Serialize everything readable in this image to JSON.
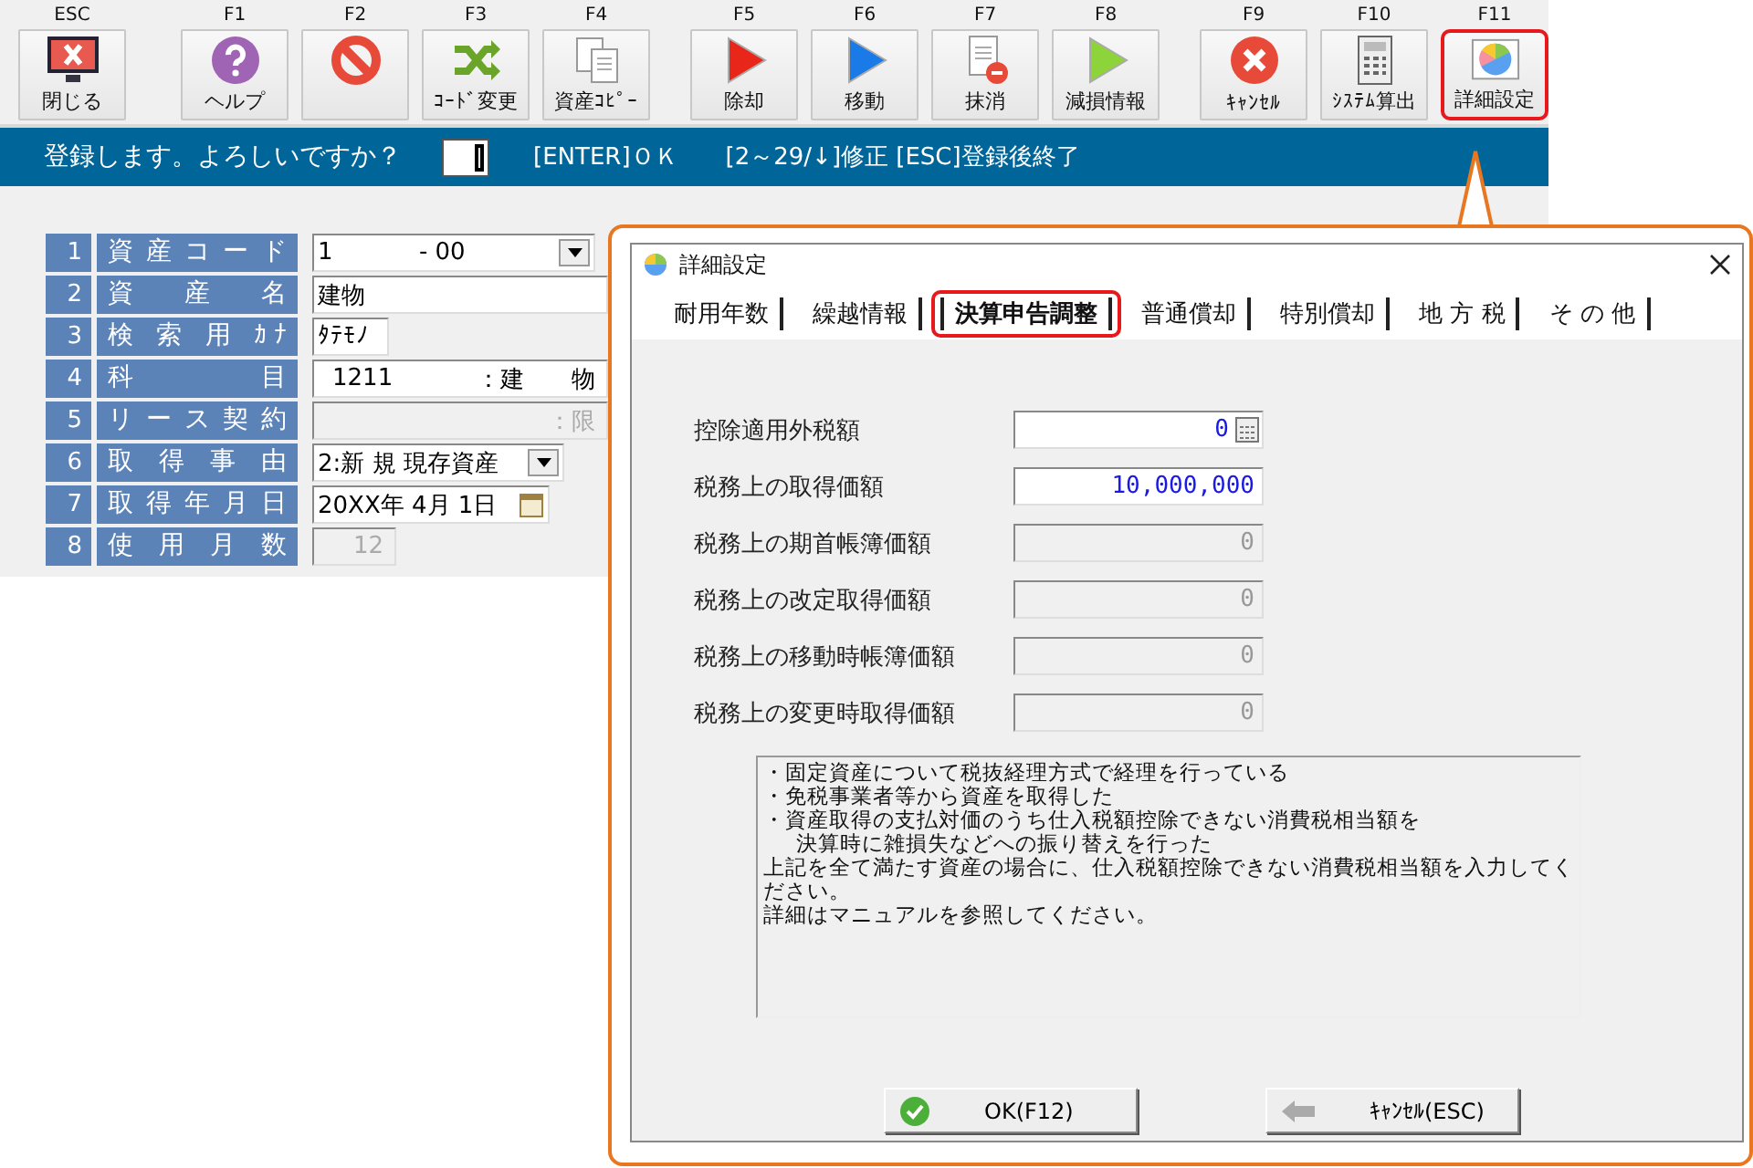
{
  "toolbar": {
    "buttons": [
      {
        "key": "ESC",
        "label": "閉じる",
        "kind": "close-monitor",
        "highlighted": false
      },
      {
        "key": "F1",
        "label": "ヘルプ",
        "kind": "help",
        "highlighted": false
      },
      {
        "key": "F2",
        "kind": "prohibit",
        "highlighted": false
      },
      {
        "key": "F3",
        "label": "ｺｰﾄﾞ変更",
        "kind": "shuffle",
        "highlighted": false
      },
      {
        "key": "F4",
        "label": "資産ｺﾋﾟｰ",
        "kind": "copy",
        "highlighted": false
      },
      {
        "key": "F5",
        "label": "除却",
        "kind": "play-red",
        "highlighted": false
      },
      {
        "key": "F6",
        "label": "移動",
        "kind": "play-blue",
        "highlighted": false
      },
      {
        "key": "F7",
        "label": "抹消",
        "kind": "doc-remove",
        "highlighted": false
      },
      {
        "key": "F8",
        "label": "減損情報",
        "kind": "play-green",
        "highlighted": false
      },
      {
        "key": "F9",
        "label": "ｷｬﾝｾﾙ",
        "kind": "cancel",
        "highlighted": false
      },
      {
        "key": "F10",
        "label": "ｼｽﾃﾑ算出",
        "kind": "calculator",
        "highlighted": false
      },
      {
        "key": "F11",
        "label": "詳細設定",
        "kind": "pie",
        "highlighted": true
      }
    ]
  },
  "prompt_bar": {
    "message": "登録します。よろしいですか？",
    "hints": [
      "[ENTER]ＯＫ",
      "[2～29/↓]修正 [ESC]登録後終了"
    ]
  },
  "form": {
    "rows": [
      {
        "number": "1",
        "label": "資 産 コ ー ド",
        "kind": "dropdown",
        "value": "1",
        "suffix": "- 00",
        "disabled": false
      },
      {
        "number": "2",
        "label": "資 産 名",
        "kind": "text",
        "value": "建物",
        "disabled": false
      },
      {
        "number": "3",
        "label": "検 索 用 ｶﾅ",
        "kind": "short",
        "value": "ﾀﾃﾓﾉ",
        "disabled": false
      },
      {
        "number": "4",
        "label": "科 目",
        "kind": "account",
        "value": "1211",
        "suffix": "：建　　物",
        "disabled": false
      },
      {
        "number": "5",
        "label": "リ ー ス 契 約",
        "kind": "account",
        "suffix": "：限",
        "disabled": true
      },
      {
        "number": "6",
        "label": "取 得 事 由",
        "kind": "dropdown",
        "value": "2:新 規 現存資産",
        "disabled": false
      },
      {
        "number": "7",
        "label": "取 得 年 月 日",
        "kind": "date",
        "value": "20XX年 4月 1日",
        "disabled": false
      },
      {
        "number": "8",
        "label": "使 用 月 数",
        "kind": "spinner",
        "value": "12",
        "disabled": true
      }
    ]
  },
  "dialog": {
    "title": "詳細設定",
    "tabs": [
      {
        "label": "耐用年数",
        "selected": false,
        "highlighted": false
      },
      {
        "label": "繰越情報",
        "selected": false,
        "highlighted": false
      },
      {
        "label": "決算申告調整",
        "selected": true,
        "highlighted": true
      },
      {
        "label": "普通償却",
        "selected": false,
        "highlighted": false
      },
      {
        "label": "特別償却",
        "selected": false,
        "highlighted": false
      },
      {
        "label": "地 方 税",
        "selected": false,
        "highlighted": false
      },
      {
        "label": "そ の 他",
        "selected": false,
        "highlighted": false
      }
    ],
    "fields": [
      {
        "label": "控除適用外税額",
        "value": "0",
        "disabled": false,
        "focused": true
      },
      {
        "label": "税務上の取得価額",
        "value": "10,000,000",
        "disabled": false,
        "focused": false
      },
      {
        "label": "税務上の期首帳簿価額",
        "value": "0",
        "disabled": true,
        "focused": false
      },
      {
        "label": "税務上の改定取得価額",
        "value": "0",
        "disabled": true,
        "focused": false
      },
      {
        "label": "税務上の移動時帳簿価額",
        "value": "0",
        "disabled": true,
        "focused": false
      },
      {
        "label": "税務上の変更時取得価額",
        "value": "0",
        "disabled": true,
        "focused": false
      }
    ],
    "notes": [
      {
        "kind": "line",
        "text": "・固定資産について税抜経理方式で経理を行っている"
      },
      {
        "kind": "line",
        "text": "・免税事業者等から資産を取得した"
      },
      {
        "kind": "line",
        "text": "・資産取得の支払対価のうち仕入税額控除できない消費税相当額を"
      },
      {
        "kind": "indent",
        "text": "決算時に雑損失などへの振り替えを行った"
      },
      {
        "kind": "line",
        "text": "上記を全て満たす資産の場合に、仕入税額控除できない消費税相当額を入力してください。"
      },
      {
        "kind": "line",
        "text": "詳細はマニュアルを参照してください。"
      }
    ],
    "buttons": [
      {
        "label": "OK(F12)",
        "kind": "ok"
      },
      {
        "label": "ｷｬﾝｾﾙ(ESC)",
        "kind": "cancel"
      }
    ]
  }
}
